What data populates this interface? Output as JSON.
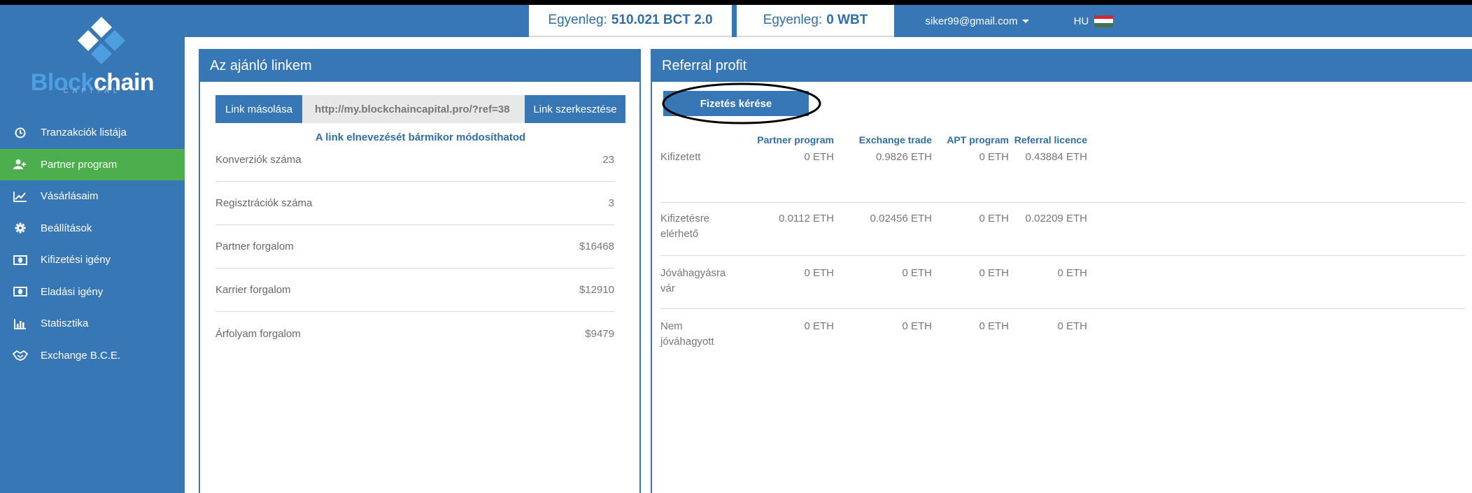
{
  "header": {
    "balance1_label": "Egyenleg:",
    "balance1_value": "510.021 BCT 2.0",
    "balance2_label": "Egyenleg:",
    "balance2_value": "0 WBT",
    "user_email": "siker99@gmail.com",
    "language": "HU"
  },
  "logo": {
    "name_part1": "Block",
    "name_part2": "chain",
    "subtitle": "CAPITAL"
  },
  "sidebar": {
    "items": [
      {
        "label": "Tranzakciók listája",
        "icon": "clock-icon"
      },
      {
        "label": "Partner program",
        "icon": "add-user-icon",
        "active": true
      },
      {
        "label": "Vásárlásaim",
        "icon": "line-chart-icon"
      },
      {
        "label": "Beállítások",
        "icon": "gear-icon"
      },
      {
        "label": "Kifizetési igény",
        "icon": "money-icon"
      },
      {
        "label": "Eladási igény",
        "icon": "money-icon"
      },
      {
        "label": "Statisztika",
        "icon": "bar-chart-icon"
      },
      {
        "label": "Exchange B.C.E.",
        "icon": "handshake-icon"
      }
    ]
  },
  "left_panel": {
    "title": "Az ajánló linkem",
    "copy_button": "Link másolása",
    "link_value": "http://my.blockchaincapital.pro/?ref=38",
    "edit_button": "Link szerkesztése",
    "note": "A link elnevezését bármikor módosíthatod",
    "stats": [
      {
        "label": "Konverziók száma",
        "value": "23"
      },
      {
        "label": "Regisztrációk száma",
        "value": "3"
      },
      {
        "label": "Partner forgalom",
        "value": "$16468"
      },
      {
        "label": "Karrier forgalom",
        "value": "$12910"
      },
      {
        "label": "Árfolyam forgalom",
        "value": "$9479"
      }
    ]
  },
  "right_panel": {
    "title": "Referral profit",
    "pay_button": "Fizetés kérése",
    "columns": [
      "Partner program",
      "Exchange trade",
      "APT program",
      "Referral licence"
    ],
    "rows": [
      {
        "label": "Kifizetett",
        "values": [
          "0 ETH",
          "0.9826 ETH",
          "0 ETH",
          "0.43884 ETH"
        ]
      },
      {
        "label": "Kifizetésre elérhető",
        "values": [
          "0.0112 ETH",
          "0.02456 ETH",
          "0 ETH",
          "0.02209 ETH"
        ]
      },
      {
        "label": "Jóváhagyásra vár",
        "values": [
          "0 ETH",
          "0 ETH",
          "0 ETH",
          "0 ETH"
        ]
      },
      {
        "label": "Nem jóváhagyott",
        "values": [
          "0 ETH",
          "0 ETH",
          "0 ETH",
          "0 ETH"
        ]
      }
    ]
  },
  "colors": {
    "brand_blue": "#3777b6",
    "active_green": "#4cae4c",
    "text_blue": "#2f6ea8"
  }
}
